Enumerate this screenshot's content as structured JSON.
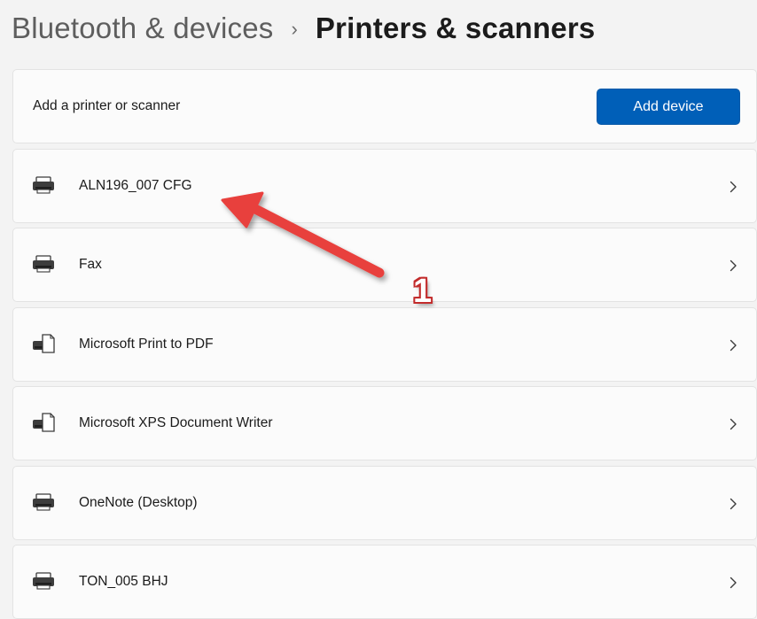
{
  "breadcrumb": {
    "parent": "Bluetooth & devices",
    "separator": "›",
    "current": "Printers & scanners"
  },
  "add_section": {
    "label": "Add a printer or scanner",
    "button_label": "Add device"
  },
  "devices": [
    {
      "name": "ALN196_007 CFG",
      "icon": "printer-icon"
    },
    {
      "name": "Fax",
      "icon": "printer-icon"
    },
    {
      "name": "Microsoft Print to PDF",
      "icon": "printer-document-icon"
    },
    {
      "name": "Microsoft XPS Document Writer",
      "icon": "printer-document-icon"
    },
    {
      "name": "OneNote (Desktop)",
      "icon": "printer-icon"
    },
    {
      "name": "TON_005 BHJ",
      "icon": "printer-icon"
    }
  ],
  "annotation": {
    "callout_number": "1",
    "arrow_color": "#e8403c"
  },
  "colors": {
    "accent": "#005fb8",
    "background": "#f3f3f3",
    "card": "#fbfbfb"
  }
}
